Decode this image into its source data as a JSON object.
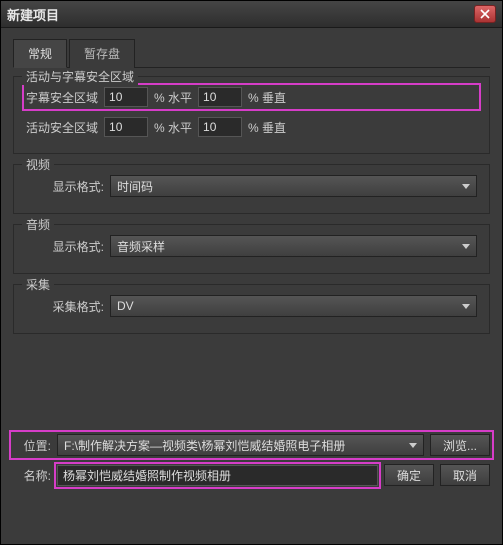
{
  "window": {
    "title": "新建项目"
  },
  "tabs": {
    "general": "常规",
    "scratch": "暂存盘"
  },
  "safeZone": {
    "title": "活动与字幕安全区域",
    "captionLabel": "字幕安全区域",
    "captionH": "10",
    "captionV": "10",
    "actionLabel": "活动安全区域",
    "actionH": "10",
    "actionV": "10",
    "pctH": "% 水平",
    "pctV": "% 垂直"
  },
  "video": {
    "title": "视频",
    "displayFormatLabel": "显示格式:",
    "displayFormatValue": "时间码"
  },
  "audio": {
    "title": "音频",
    "displayFormatLabel": "显示格式:",
    "displayFormatValue": "音频采样"
  },
  "capture": {
    "title": "采集",
    "captureFormatLabel": "采集格式:",
    "captureFormatValue": "DV"
  },
  "footer": {
    "locationLabel": "位置:",
    "locationValue": "F:\\制作解决方案—视频类\\杨幂刘恺威结婚照电子相册",
    "browse": "浏览...",
    "nameLabel": "名称:",
    "nameValue": "杨幂刘恺威结婚照制作视频相册",
    "ok": "确定",
    "cancel": "取消"
  }
}
